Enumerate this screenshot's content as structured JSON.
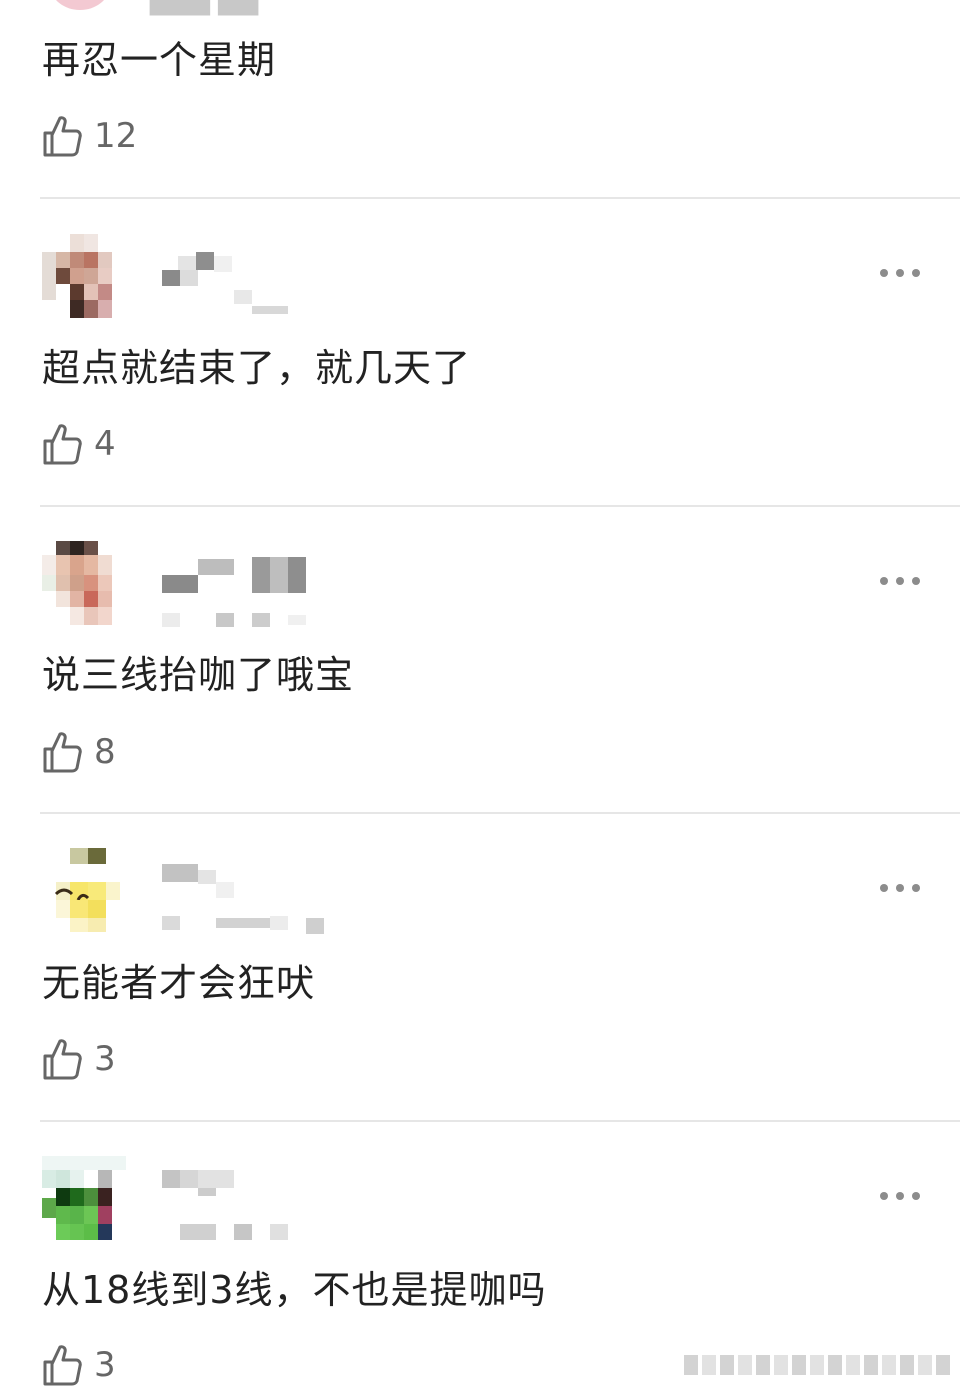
{
  "comments": [
    {
      "text": "再忍一个星期",
      "likes": "12"
    },
    {
      "text": "超点就结束了，就几天了",
      "likes": "4"
    },
    {
      "text": "说三线抬咖了哦宝",
      "likes": "8"
    },
    {
      "text": "无能者才会狂吠",
      "likes": "3"
    },
    {
      "text": "从18线到3线，不也是提咖吗",
      "likes": "3"
    }
  ],
  "icons": {
    "like": "thumb-up-outline-icon",
    "more": "more-horizontal-icon"
  },
  "colors": {
    "text": "#222222",
    "count": "#666666",
    "divider": "#e6e6e6",
    "more_dots": "#8c8c8c"
  }
}
